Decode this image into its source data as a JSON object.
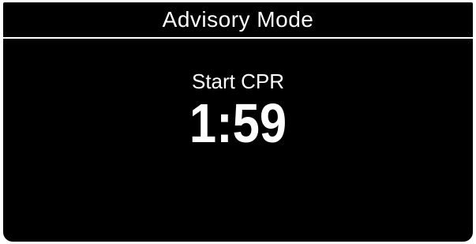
{
  "header": {
    "title": "Advisory Mode"
  },
  "main": {
    "prompt": "Start CPR",
    "timer": "1:59"
  },
  "colors": {
    "background": "#000000",
    "foreground": "#ffffff"
  }
}
